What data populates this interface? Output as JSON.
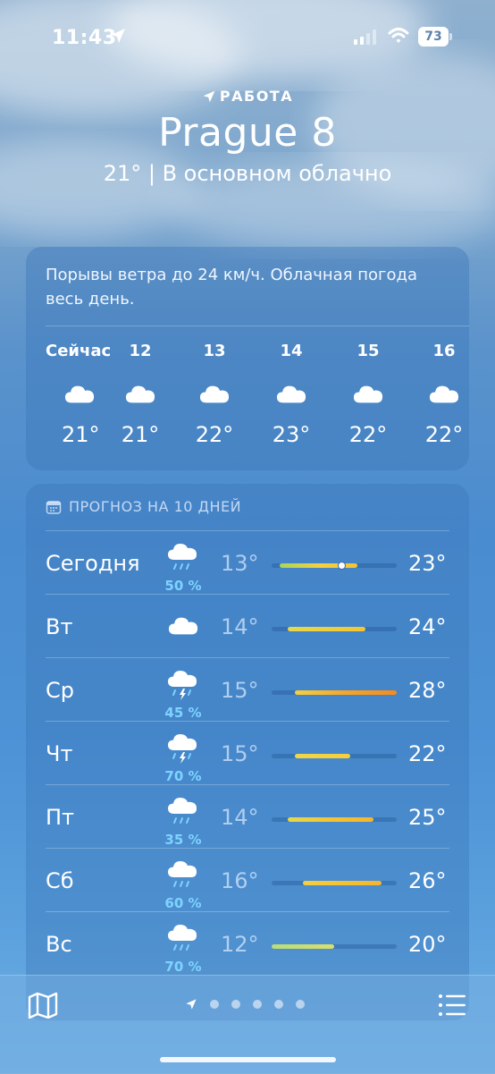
{
  "status_bar": {
    "time": "11:43",
    "battery": "73"
  },
  "header": {
    "location_label": "РАБОТА",
    "city": "Prague 8",
    "summary": "21°  |  В основном облачно"
  },
  "hourly_card": {
    "description": "Порывы ветра до 24 км/ч. Облачная погода весь день.",
    "hours": [
      {
        "label": "Сейчас",
        "icon": "cloud-icon",
        "temp": "21°"
      },
      {
        "label": "12",
        "icon": "cloud-icon",
        "temp": "21°"
      },
      {
        "label": "13",
        "icon": "cloud-icon",
        "temp": "22°"
      },
      {
        "label": "14",
        "icon": "cloud-icon",
        "temp": "23°"
      },
      {
        "label": "15",
        "icon": "cloud-icon",
        "temp": "22°"
      },
      {
        "label": "16",
        "icon": "cloud-icon",
        "temp": "22°"
      }
    ]
  },
  "forecast": {
    "title": "ПРОГНОЗ НА 10 ДНЕЙ",
    "range_min": 12,
    "range_max": 28,
    "days": [
      {
        "day": "Сегодня",
        "icon": "cloud-rain-icon",
        "precip": "50 %",
        "low": "13°",
        "high": "23°",
        "lo_val": 13,
        "hi_val": 23,
        "current": 21,
        "colors": [
          "#a6d65a",
          "#f4d03f",
          "#f4c430"
        ]
      },
      {
        "day": "Вт",
        "icon": "cloud-icon",
        "precip": "",
        "low": "14°",
        "high": "24°",
        "lo_val": 14,
        "hi_val": 24,
        "colors": [
          "#e6d84a",
          "#f5c431"
        ]
      },
      {
        "day": "Ср",
        "icon": "cloud-thunderstorm-icon",
        "precip": "45 %",
        "low": "15°",
        "high": "28°",
        "lo_val": 15,
        "hi_val": 28,
        "colors": [
          "#f4d03f",
          "#f7a526",
          "#f58a1f"
        ]
      },
      {
        "day": "Чт",
        "icon": "cloud-thunderstorm-icon",
        "precip": "70 %",
        "low": "15°",
        "high": "22°",
        "lo_val": 15,
        "hi_val": 22,
        "colors": [
          "#f0d648",
          "#f5cf3c"
        ]
      },
      {
        "day": "Пт",
        "icon": "cloud-rain-icon",
        "precip": "35 %",
        "low": "14°",
        "high": "25°",
        "lo_val": 14,
        "hi_val": 25,
        "colors": [
          "#e6d84a",
          "#f5c431",
          "#f6b52b"
        ]
      },
      {
        "day": "Сб",
        "icon": "cloud-rain-icon",
        "precip": "60 %",
        "low": "16°",
        "high": "26°",
        "lo_val": 16,
        "hi_val": 26,
        "colors": [
          "#f4d03f",
          "#f6b52b"
        ]
      },
      {
        "day": "Вс",
        "icon": "cloud-rain-icon",
        "precip": "70 %",
        "low": "12°",
        "high": "20°",
        "lo_val": 12,
        "hi_val": 20,
        "colors": [
          "#b9dd7a",
          "#d8e06a"
        ]
      }
    ]
  },
  "bottom_bar": {
    "pages": 5
  }
}
